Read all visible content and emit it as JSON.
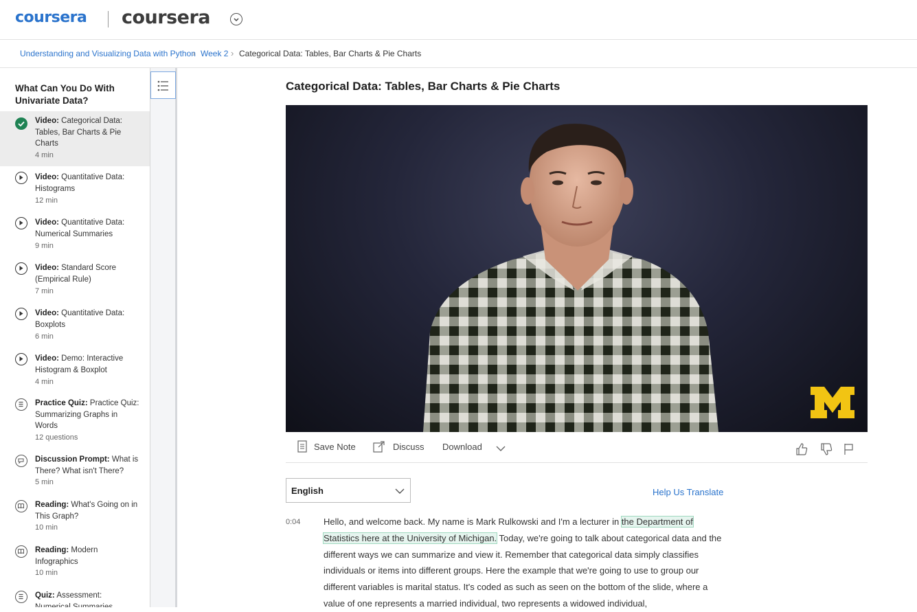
{
  "header": {
    "logo_primary": "coursera",
    "logo_partner": "coursera"
  },
  "breadcrumb": {
    "course": "Understanding and Visualizing Data with Python",
    "week": "Week 2",
    "current": "Categorical Data: Tables, Bar Charts & Pie Charts"
  },
  "sidebar": {
    "title": "What Can You Do With Univariate Data?",
    "items": [
      {
        "type": "Video:",
        "title": "Categorical Data: Tables, Bar Charts & Pie Charts",
        "duration": "4 min",
        "icon": "check-circle-icon",
        "active": true
      },
      {
        "type": "Video:",
        "title": "Quantitative Data: Histograms",
        "duration": "12 min",
        "icon": "play-circle-icon"
      },
      {
        "type": "Video:",
        "title": "Quantitative Data: Numerical Summaries",
        "duration": "9 min",
        "icon": "play-circle-icon"
      },
      {
        "type": "Video:",
        "title": "Standard Score (Empirical Rule)",
        "duration": "7 min",
        "icon": "play-circle-icon"
      },
      {
        "type": "Video:",
        "title": "Quantitative Data: Boxplots",
        "duration": "6 min",
        "icon": "play-circle-icon"
      },
      {
        "type": "Video:",
        "title": "Demo: Interactive Histogram & Boxplot",
        "duration": "4 min",
        "icon": "play-circle-icon"
      },
      {
        "type": "Practice Quiz:",
        "title": "Practice Quiz: Summarizing Graphs in Words",
        "duration": "12 questions",
        "icon": "quiz-icon"
      },
      {
        "type": "Discussion Prompt:",
        "title": "What is There? What isn't There?",
        "duration": "5 min",
        "icon": "discussion-icon"
      },
      {
        "type": "Reading:",
        "title": "What's Going on in This Graph?",
        "duration": "10 min",
        "icon": "reading-icon"
      },
      {
        "type": "Reading:",
        "title": "Modern Infographics",
        "duration": "10 min",
        "icon": "reading-icon"
      },
      {
        "type": "Quiz:",
        "title": "Assessment: Numerical Summaries",
        "duration": "",
        "icon": "quiz-icon"
      }
    ]
  },
  "main": {
    "title": "Categorical Data: Tables, Bar Charts & Pie Charts",
    "video_logo": "M",
    "toolbar": {
      "save_note": "Save Note",
      "discuss": "Discuss",
      "download": "Download"
    },
    "language": "English",
    "help_translate": "Help Us Translate",
    "transcript": {
      "timestamp": "0:04",
      "before": "Hello, and welcome back. My name is Mark Rulkowski and I'm a lecturer in ",
      "highlight": "the Department of Statistics here at the University of Michigan.",
      "after": " Today, we're going to talk about categorical data and the different ways we can summarize and view it. Remember that categorical data simply classifies individuals or items into different groups. Here the example that we're going to use to group our different variables is marital status. It's coded as such as seen on the bottom of the slide, where a value of one represents a married individual, two represents a widowed individual,"
    }
  },
  "colors": {
    "accent": "#2a73cc",
    "complete": "#1f8354",
    "highlight_bg": "#e6f5ef",
    "michigan_maize": "#f2c413"
  }
}
